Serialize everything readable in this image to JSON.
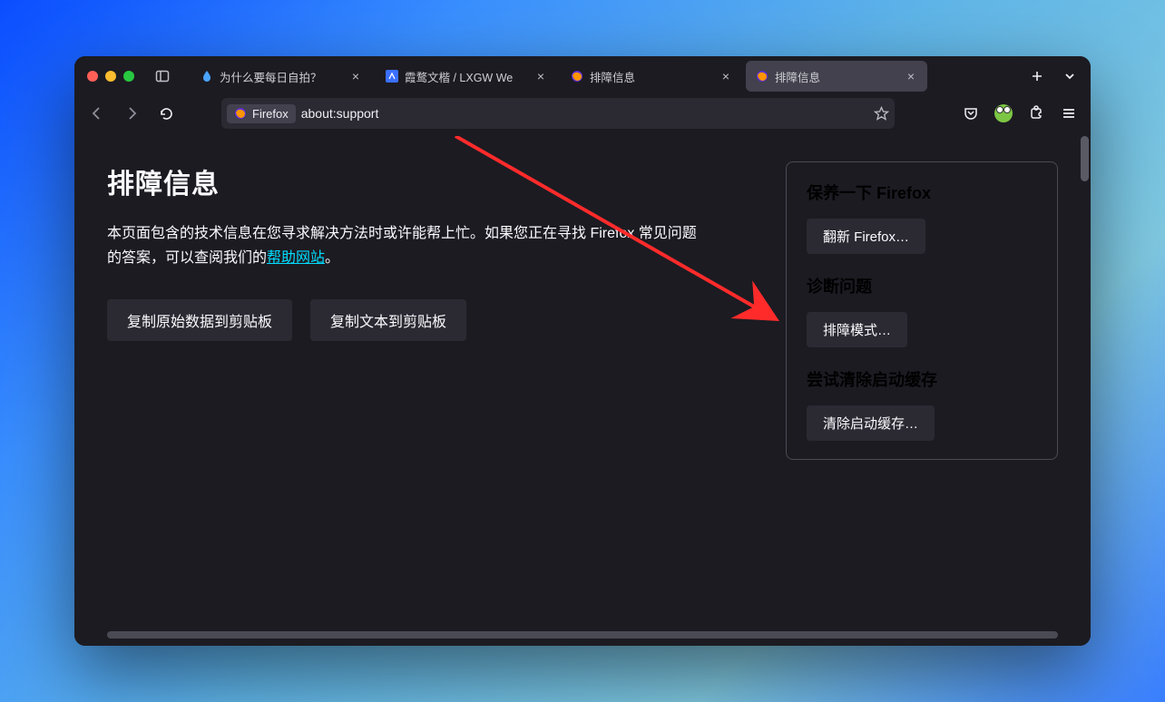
{
  "window": {
    "tabs": [
      {
        "label": "为什么要每日自拍？",
        "icon": "drop"
      },
      {
        "label": "霞鹜文楷 / LXGW We",
        "icon": "blueicon"
      },
      {
        "label": "排障信息",
        "icon": "firefox"
      },
      {
        "label": "排障信息",
        "icon": "firefox",
        "active": true
      }
    ]
  },
  "urlbar": {
    "identity_label": "Firefox",
    "url": "about:support"
  },
  "page": {
    "title": "排障信息",
    "intro_prefix": "本页面包含的技术信息在您寻求解决方法时或许能帮上忙。如果您正在寻找 Firefox 常见问题的答案，可以查阅我们的",
    "intro_link": "帮助网站",
    "intro_suffix": "。",
    "copy_raw": "复制原始数据到剪贴板",
    "copy_text": "复制文本到剪贴板"
  },
  "actions": {
    "refresh_heading": "保养一下 Firefox",
    "refresh_button": "翻新 Firefox…",
    "diagnose_heading": "诊断问题",
    "diagnose_button": "排障模式…",
    "cache_heading": "尝试清除启动缓存",
    "cache_button": "清除启动缓存…"
  }
}
